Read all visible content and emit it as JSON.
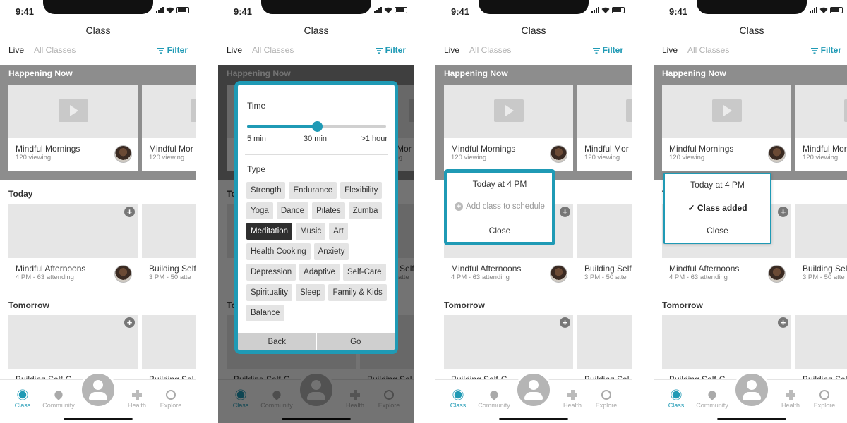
{
  "status": {
    "time": "9:41"
  },
  "header": {
    "title": "Class"
  },
  "tabs": {
    "live": "Live",
    "all": "All Classes",
    "filter": "Filter"
  },
  "sections": {
    "happening": "Happening Now",
    "today": "Today",
    "tomorrow": "Tomorrow"
  },
  "cards": {
    "happening": [
      {
        "name": "Mindful Mornings",
        "sub": "120 viewing"
      },
      {
        "name": "Mindful Mor",
        "sub": "120 viewing"
      }
    ],
    "today": [
      {
        "name": "Mindful Afternoons",
        "sub": "4 PM - 63 attending"
      },
      {
        "name": "Building Self",
        "sub": "3 PM - 50 atte"
      }
    ],
    "tomorrow": [
      {
        "name": "Building Self-C",
        "sub": ""
      },
      {
        "name": "Building Sel",
        "sub": ""
      }
    ]
  },
  "nav": {
    "class": "Class",
    "community": "Community",
    "health": "Health",
    "explore": "Explore"
  },
  "filter_modal": {
    "time_label": "Time",
    "slider_value_fraction": 0.5,
    "ticks": [
      "5 min",
      "30 min",
      ">1 hour"
    ],
    "type_label": "Type",
    "chips": [
      "Strength",
      "Endurance",
      "Flexibility",
      "Yoga",
      "Dance",
      "Pilates",
      "Zumba",
      "Meditation",
      "Music",
      "Art",
      "Health Cooking",
      "Anxiety",
      "Depression",
      "Adaptive",
      "Self-Care",
      "Spirituality",
      "Sleep",
      "Family & Kids",
      "Balance"
    ],
    "selected_chip": "Meditation",
    "back": "Back",
    "go": "Go"
  },
  "popup": {
    "when": "Today at 4 PM",
    "add": "Add class to schedule",
    "added": "Class added",
    "close": "Close"
  },
  "colors": {
    "accent": "#1f9ab5",
    "grey_band": "#8d8d8d",
    "chip_selected": "#2f2f2f"
  }
}
